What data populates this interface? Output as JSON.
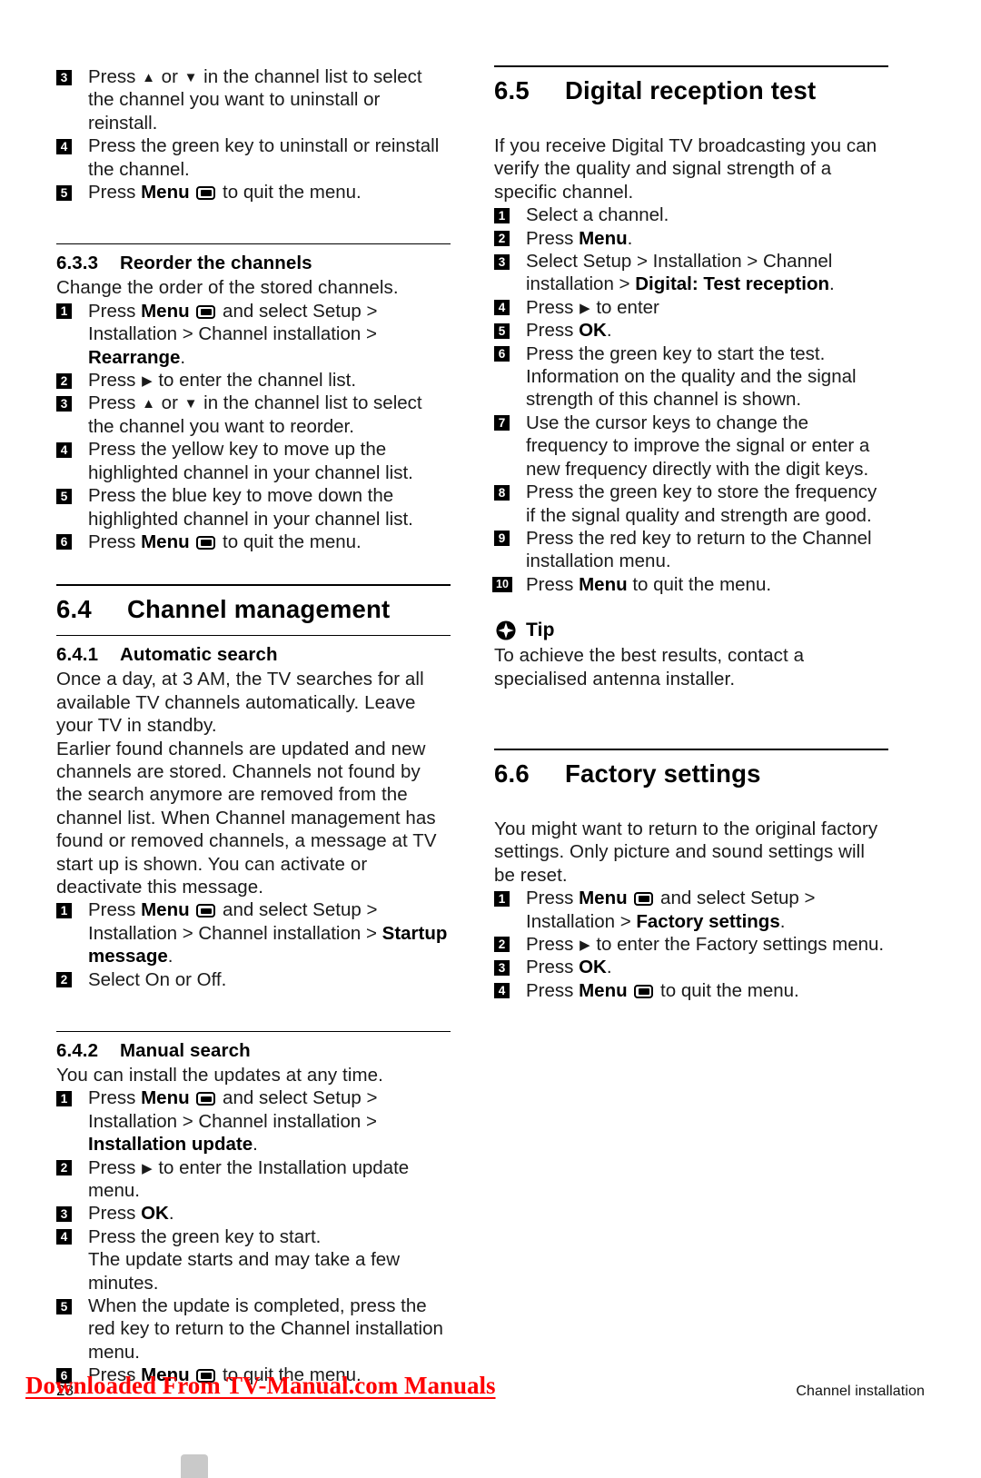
{
  "document": {
    "page_number": "28",
    "footer_section": "Channel installation",
    "watermark": "Downloaded From TV-Manual.com Manuals"
  },
  "icons": {
    "menu": "menu-tv-icon",
    "tip": "tip-star-icon",
    "arrow_up": "▲",
    "arrow_down": "▼",
    "arrow_right": "▶"
  },
  "left_column": {
    "continued_steps": [
      {
        "n": "3",
        "html": "Press <span class='arrow-up'>▲</span> or <span class='arrow-dn'>▼</span> in the channel list to select the channel you want to uninstall or reinstall."
      },
      {
        "n": "4",
        "html": "Press the green key to uninstall or reinstall the channel."
      },
      {
        "n": "5",
        "html": "Press <b>Menu</b> <span class='menu-icon'></span> to quit the menu."
      }
    ],
    "section_633": {
      "number": "6.3.3",
      "title": "Reorder the channels",
      "intro": "Change the order of the stored channels.",
      "steps": [
        {
          "n": "1",
          "html": "Press <b>Menu</b> <span class='menu-icon'></span> and select Setup &gt; Installation &gt; Channel installation &gt; <b>Rearrange</b>."
        },
        {
          "n": "2",
          "html": "Press <span class='arrow-rt'>▶</span> to enter the channel list."
        },
        {
          "n": "3",
          "html": "Press <span class='arrow-up'>▲</span> or <span class='arrow-dn'>▼</span> in the channel list to select the channel you want to reorder."
        },
        {
          "n": "4",
          "html": "Press the yellow key to move up the highlighted channel in your channel list."
        },
        {
          "n": "5",
          "html": "Press the blue key to move down the highlighted channel in your channel list."
        },
        {
          "n": "6",
          "html": "Press <b>Menu</b> <span class='menu-icon'></span> to quit the menu."
        }
      ]
    },
    "section_64": {
      "number": "6.4",
      "title": "Channel management"
    },
    "section_641": {
      "number": "6.4.1",
      "title": "Automatic search",
      "paragraph1": "Once a day, at 3 AM, the TV searches for all available TV channels automatically. Leave your TV in standby.",
      "paragraph2": "Earlier found channels are updated and new channels are stored. Channels not found by the search anymore are removed from the channel list. When Channel management has found or removed channels, a message at TV start up is shown. You can activate or deactivate this message.",
      "steps": [
        {
          "n": "1",
          "html": "Press <b>Menu</b> <span class='menu-icon'></span> and select Setup &gt; Installation &gt; Channel installation &gt; <b>Startup message</b>."
        },
        {
          "n": "2",
          "html": "Select On or Off."
        }
      ]
    },
    "section_642": {
      "number": "6.4.2",
      "title": "Manual search",
      "intro": "You can install the updates at any time.",
      "steps": [
        {
          "n": "1",
          "html": "Press <b>Menu</b> <span class='menu-icon'></span> and select Setup &gt; Installation &gt; Channel installation &gt; <b>Installation update</b>."
        },
        {
          "n": "2",
          "html": "Press <span class='arrow-rt'>▶</span> to enter the Installation update menu."
        },
        {
          "n": "3",
          "html": "Press <b>OK</b>."
        },
        {
          "n": "4",
          "html": "Press the green key to start.",
          "note": "The update starts and may take a few minutes."
        },
        {
          "n": "5",
          "html": "When the update is completed, press the red key to return to the Channel installation menu."
        },
        {
          "n": "6",
          "html": "Press <b>Menu</b> <span class='menu-icon'></span> to quit the menu."
        }
      ]
    }
  },
  "right_column": {
    "section_65": {
      "number": "6.5",
      "title": "Digital reception test",
      "intro": "If you receive Digital TV broadcasting you can verify the quality and signal strength of a specific channel.",
      "steps": [
        {
          "n": "1",
          "html": "Select a channel."
        },
        {
          "n": "2",
          "html": "Press <b>Menu</b>."
        },
        {
          "n": "3",
          "html": "Select Setup &gt; Installation &gt; Channel installation &gt; <b>Digital: Test reception</b>."
        },
        {
          "n": "4",
          "html": "Press <span class='arrow-rt'>▶</span> to enter"
        },
        {
          "n": "5",
          "html": "Press <b>OK</b>."
        },
        {
          "n": "6",
          "html": "Press the green key to start the test.",
          "note": "Information on the quality and the signal strength of this channel is shown."
        },
        {
          "n": "7",
          "html": "Use the cursor keys to change the frequency to improve the signal or enter a new frequency directly with the digit keys."
        },
        {
          "n": "8",
          "html": "Press the green key to store the frequency if the signal quality and strength are good."
        },
        {
          "n": "9",
          "html": "Press the red key to return to the Channel installation menu."
        },
        {
          "n": "10",
          "html": "Press <b>Menu</b> to quit the menu."
        }
      ],
      "tip": {
        "label": "Tip",
        "text": "To achieve the best results, contact a specialised antenna installer."
      }
    },
    "section_66": {
      "number": "6.6",
      "title": "Factory settings",
      "intro": "You might want to return to the original factory settings. Only picture and sound settings will be reset.",
      "steps": [
        {
          "n": "1",
          "html": "Press <b>Menu</b> <span class='menu-icon'></span> and select Setup &gt; Installation &gt; <b>Factory settings</b>."
        },
        {
          "n": "2",
          "html": "Press <span class='arrow-rt'>▶</span> to enter the Factory settings menu."
        },
        {
          "n": "3",
          "html": "Press <b>OK</b>."
        },
        {
          "n": "4",
          "html": "Press <b>Menu</b> <span class='menu-icon'></span> to quit the menu."
        }
      ]
    }
  }
}
